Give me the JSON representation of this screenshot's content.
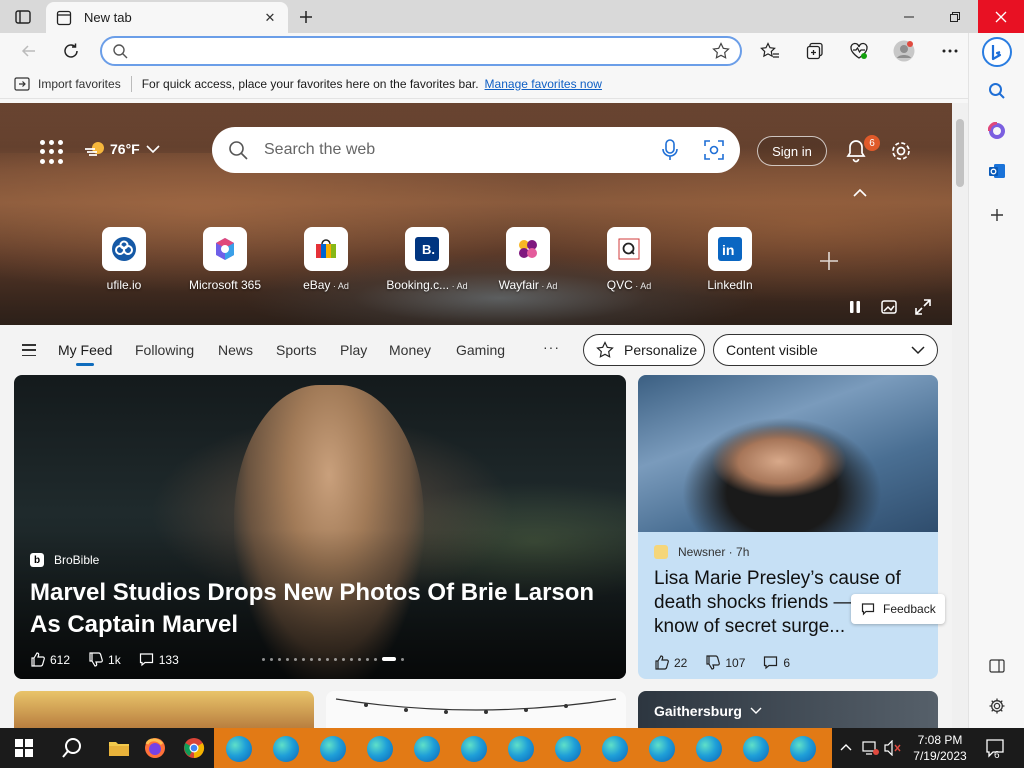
{
  "browser": {
    "tab_title": "New tab",
    "address_value": "",
    "favbar": {
      "import_label": "Import favorites",
      "message": "For quick access, place your favorites here on the favorites bar.",
      "link": "Manage favorites now"
    }
  },
  "hero": {
    "weather": "76°F",
    "search_placeholder": "Search the web",
    "signin": "Sign in",
    "notifications_count": "6",
    "quick_links": [
      {
        "label": "ufile.io",
        "ad": ""
      },
      {
        "label": "Microsoft 365",
        "ad": ""
      },
      {
        "label": "eBay",
        "ad": " · Ad"
      },
      {
        "label": "Booking.c...",
        "ad": " · Ad"
      },
      {
        "label": "Wayfair",
        "ad": " · Ad"
      },
      {
        "label": "QVC",
        "ad": " · Ad"
      },
      {
        "label": "LinkedIn",
        "ad": ""
      }
    ]
  },
  "feed_nav": {
    "items": [
      "My Feed",
      "Following",
      "News",
      "Sports",
      "Play",
      "Money",
      "Gaming"
    ],
    "more": "···",
    "personalize": "Personalize",
    "content_visible": "Content visible"
  },
  "cards": {
    "main": {
      "source": "BroBible",
      "title": "Marvel Studios Drops New Photos Of Brie Larson As Captain Marvel",
      "likes": "612",
      "dislikes": "1k",
      "comments": "133"
    },
    "side": {
      "source": "Newsner · 7h",
      "title": "Lisa Marie Presley’s cause of death shocks friends — didn’t know of secret surge...",
      "likes": "22",
      "dislikes": "107",
      "comments": "6"
    },
    "weather_card_location": "Gaithersburg",
    "feedback": "Feedback"
  },
  "taskbar": {
    "time": "7:08 PM",
    "date": "7/19/2023",
    "notifications": "6"
  },
  "colors": {
    "accent": "#0f6cbd",
    "close_red": "#e81123",
    "taskbar_orange": "#e27a15",
    "side_card_bg": "#c6e0f5"
  }
}
